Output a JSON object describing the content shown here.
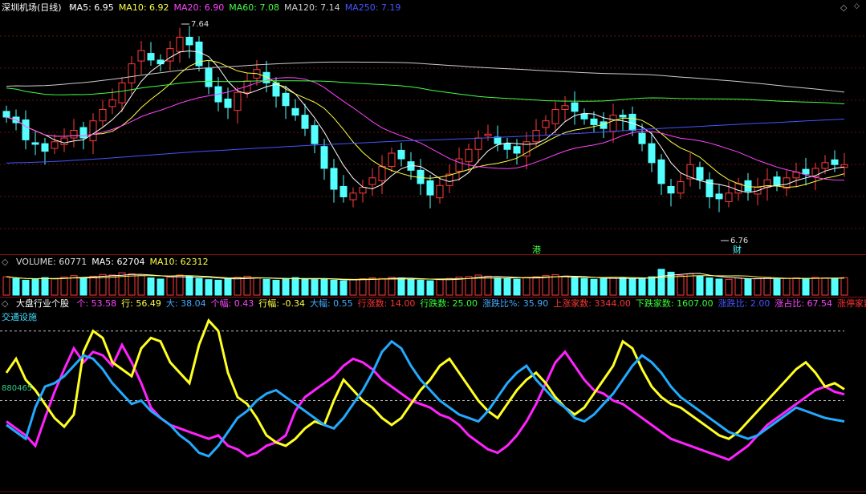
{
  "price_panel": {
    "stock_title": "深圳机场(日线)",
    "ma_items": [
      {
        "label": "MA5: 6.95",
        "color": "#ffffff"
      },
      {
        "label": "MA10: 6.92",
        "color": "#ffff44"
      },
      {
        "label": "MA20: 6.90",
        "color": "#ff44ff"
      },
      {
        "label": "MA60: 7.08",
        "color": "#44ff44"
      },
      {
        "label": "MA120: 7.14",
        "color": "#cccccc"
      },
      {
        "label": "MA250: 7.19",
        "color": "#4455ff"
      }
    ],
    "high_marker": "7.64",
    "low_marker": "6.76",
    "event_tag_1": "港",
    "event_tag_2": "财",
    "nav_left": "◇",
    "nav_right": "◇"
  },
  "volume_panel": {
    "items": [
      {
        "label": "VOLUME: 60771",
        "color": "#dddddd"
      },
      {
        "label": "MA5: 62704",
        "color": "#ffffff"
      },
      {
        "label": "MA10: 62312",
        "color": "#ffff44"
      }
    ]
  },
  "indicator_panel": {
    "title": "大盘行业个股",
    "items": [
      {
        "label": "个: 53.58",
        "color": "#ff44ff"
      },
      {
        "label": "行: 56.49",
        "color": "#ffff44"
      },
      {
        "label": "大: 38.04",
        "color": "#44aaff"
      },
      {
        "label": "个幅: 0.43",
        "color": "#ff44ff"
      },
      {
        "label": "行幅: -0.34",
        "color": "#ffff44"
      },
      {
        "label": "大幅: 0.55",
        "color": "#44aaff"
      },
      {
        "label": "行涨数: 14.00",
        "color": "#ff3333"
      },
      {
        "label": "行跌数: 25.00",
        "color": "#33ff33"
      },
      {
        "label": "涨跌比%: 35.90",
        "color": "#44aaff"
      },
      {
        "label": "上涨家数: 3344.00",
        "color": "#ff3333"
      },
      {
        "label": "下跌家数: 1607.00",
        "color": "#33ff33"
      },
      {
        "label": "涨跌比: 2.00",
        "color": "#4455ff"
      },
      {
        "label": "涨占比: 67.54",
        "color": "#ff44ff"
      },
      {
        "label": "涨停家数",
        "color": "#ff3333"
      }
    ],
    "industry_label": "交通设施",
    "code_label": "880465"
  },
  "chart_data": [
    {
      "type": "line",
      "title": "深圳机场(日线)",
      "subtype": "candlestick",
      "ylim": [
        6.55,
        7.74
      ],
      "x_count": 88,
      "close": [
        7.2,
        7.17,
        7.08,
        7.06,
        7.02,
        7.07,
        7.09,
        7.13,
        7.09,
        7.18,
        7.24,
        7.29,
        7.38,
        7.48,
        7.55,
        7.5,
        7.48,
        7.56,
        7.62,
        7.58,
        7.47,
        7.36,
        7.28,
        7.25,
        7.33,
        7.39,
        7.45,
        7.38,
        7.31,
        7.26,
        7.21,
        7.14,
        7.06,
        6.93,
        6.82,
        6.78,
        6.8,
        6.83,
        6.88,
        6.94,
        7.01,
        6.98,
        6.92,
        6.85,
        6.79,
        6.84,
        6.9,
        6.98,
        7.03,
        7.09,
        7.11,
        7.06,
        7.03,
        7.01,
        7.07,
        7.13,
        7.18,
        7.24,
        7.26,
        7.23,
        7.19,
        7.16,
        7.14,
        7.21,
        7.2,
        7.13,
        7.06,
        6.96,
        6.85,
        6.8,
        6.86,
        6.95,
        6.87,
        6.78,
        6.77,
        6.8,
        6.85,
        6.81,
        6.83,
        6.87,
        6.84,
        6.88,
        6.91,
        6.9,
        6.93,
        6.96,
        6.95,
        6.95
      ],
      "series": [
        {
          "name": "MA5",
          "color": "#ffffff"
        },
        {
          "name": "MA10",
          "color": "#ffff44"
        },
        {
          "name": "MA20",
          "color": "#ff44ff"
        },
        {
          "name": "MA60",
          "color": "#44ff44"
        },
        {
          "name": "MA120",
          "color": "#cccccc"
        },
        {
          "name": "MA250",
          "color": "#4455ff"
        }
      ],
      "annotations": [
        {
          "text": "7.64"
        },
        {
          "text": "6.76"
        }
      ]
    },
    {
      "type": "bar",
      "title": "VOLUME",
      "values": [
        64,
        58,
        52,
        55,
        61,
        57,
        63,
        68,
        60,
        66,
        72,
        70,
        78,
        74,
        68,
        60,
        56,
        63,
        70,
        66,
        58,
        54,
        52,
        57,
        62,
        66,
        60,
        55,
        52,
        58,
        61,
        57,
        54,
        56,
        52,
        50,
        54,
        57,
        60,
        58,
        62,
        60,
        55,
        52,
        50,
        54,
        58,
        63,
        65,
        70,
        66,
        60,
        58,
        55,
        62,
        64,
        68,
        71,
        66,
        60,
        58,
        55,
        57,
        62,
        60,
        56,
        58,
        64,
        90,
        80,
        68,
        74,
        66,
        60,
        56,
        55,
        60,
        56,
        58,
        62,
        55,
        58,
        60,
        57,
        62,
        60,
        59,
        60.771
      ]
    },
    {
      "type": "line",
      "title": "大盘行业个股",
      "ylim": [
        0,
        100
      ],
      "series": [
        {
          "name": "个",
          "color": "#ff22ff",
          "values": [
            38,
            34,
            30,
            24,
            40,
            55,
            68,
            80,
            72,
            78,
            76,
            70,
            82,
            72,
            60,
            46,
            40,
            36,
            34,
            32,
            30,
            28,
            30,
            24,
            22,
            18,
            20,
            24,
            26,
            30,
            44,
            52,
            56,
            60,
            64,
            70,
            74,
            72,
            68,
            62,
            58,
            54,
            50,
            48,
            46,
            42,
            40,
            36,
            30,
            26,
            22,
            20,
            24,
            30,
            38,
            48,
            60,
            72,
            78,
            70,
            62,
            56,
            54,
            50,
            48,
            44,
            40,
            36,
            32,
            28,
            26,
            24,
            22,
            20,
            18,
            16,
            20,
            24,
            30,
            36,
            40,
            44,
            48,
            52,
            56,
            58,
            55,
            53.58
          ]
        },
        {
          "name": "行",
          "color": "#ffff22",
          "values": [
            66,
            74,
            62,
            56,
            48,
            40,
            35,
            42,
            78,
            90,
            86,
            72,
            68,
            64,
            80,
            86,
            84,
            72,
            66,
            60,
            82,
            96,
            90,
            66,
            52,
            48,
            40,
            30,
            26,
            24,
            28,
            34,
            38,
            36,
            50,
            62,
            56,
            50,
            46,
            40,
            36,
            40,
            48,
            56,
            62,
            70,
            74,
            66,
            58,
            50,
            44,
            40,
            48,
            56,
            62,
            66,
            60,
            52,
            46,
            42,
            46,
            54,
            62,
            70,
            84,
            80,
            68,
            58,
            52,
            48,
            46,
            42,
            38,
            34,
            30,
            28,
            32,
            38,
            44,
            50,
            56,
            62,
            68,
            72,
            66,
            58,
            60,
            56.49
          ]
        },
        {
          "name": "大",
          "color": "#22aaff",
          "values": [
            36,
            32,
            28,
            46,
            58,
            60,
            64,
            70,
            76,
            74,
            68,
            60,
            54,
            48,
            50,
            44,
            40,
            36,
            30,
            26,
            20,
            18,
            24,
            32,
            40,
            44,
            50,
            54,
            56,
            52,
            48,
            44,
            40,
            36,
            34,
            40,
            48,
            56,
            66,
            78,
            84,
            80,
            70,
            62,
            56,
            50,
            46,
            42,
            40,
            38,
            44,
            52,
            60,
            66,
            70,
            62,
            56,
            50,
            46,
            40,
            38,
            42,
            48,
            54,
            62,
            70,
            76,
            72,
            66,
            58,
            52,
            48,
            44,
            40,
            36,
            32,
            30,
            28,
            30,
            34,
            38,
            42,
            46,
            44,
            42,
            40,
            39,
            38.04
          ]
        }
      ]
    }
  ]
}
